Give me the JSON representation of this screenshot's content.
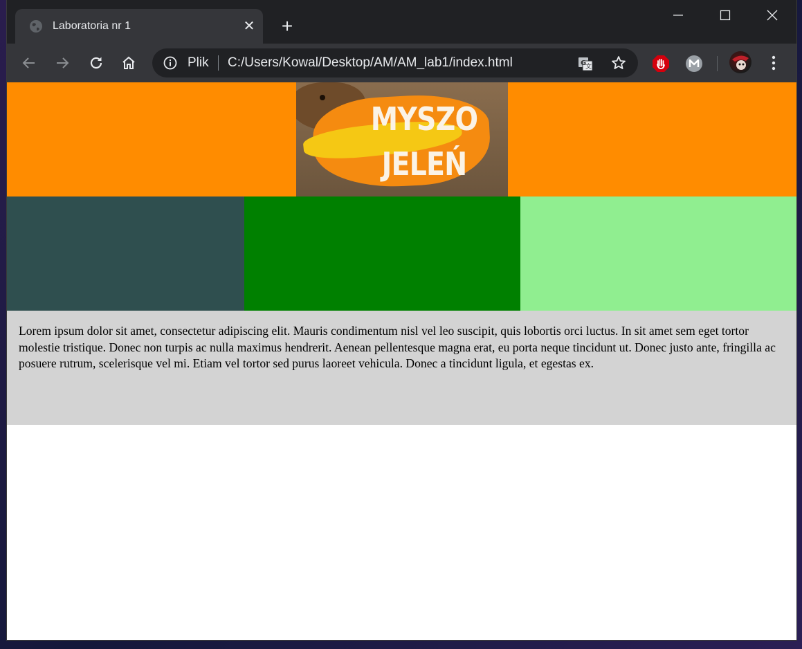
{
  "browser": {
    "tab": {
      "title": "Laboratoria nr 1",
      "close": "✕"
    },
    "new_tab": "+",
    "omnibox": {
      "scheme_label": "Plik",
      "url": "C:/Users/Kowal/Desktop/AM/AM_lab1/index.html"
    }
  },
  "page": {
    "header": {
      "bg_color": "#ff8c00",
      "banner_line1": "MYSZO",
      "banner_line2": "JELEŃ"
    },
    "columns": [
      {
        "color": "#2f4f4f"
      },
      {
        "color": "#008000"
      },
      {
        "color": "#90ee90"
      }
    ],
    "text_block": {
      "bg_color": "#d3d3d3",
      "text": "Lorem ipsum dolor sit amet, consectetur adipiscing elit. Mauris condimentum nisl vel leo suscipit, quis lobortis orci luctus. In sit amet sem eget tortor molestie tristique. Donec non turpis ac nulla maximus hendrerit. Aenean pellentesque magna erat, eu porta neque tincidunt ut. Donec justo ante, fringilla ac posuere rutrum, scelerisque vel mi. Etiam vel tortor sed purus laoreet vehicula. Donec a tincidunt ligula, et egestas ex."
    }
  }
}
